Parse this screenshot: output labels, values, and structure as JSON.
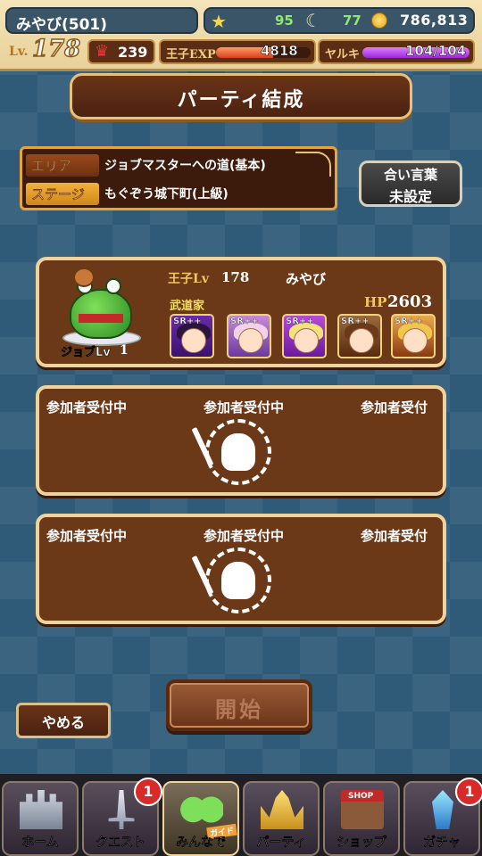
{
  "status": {
    "player_name": "みやび(501)",
    "stamina": "95",
    "gems": "77",
    "gold": "786,813",
    "level_label": "Lv.",
    "level": "178",
    "crowns": "239",
    "exp_label": "王子EXP",
    "exp_value": "4818",
    "exp_fill_percent": 60,
    "yaruki_label": "ヤルキ",
    "yaruki_value": "104/104",
    "yaruki_fill_percent": 100
  },
  "title": "パーティ結成",
  "area": {
    "area_key": "エリア",
    "area_value": "ジョブマスターへの道(基本)",
    "stage_key": "ステージ",
    "stage_value": "もぐぞう城下町(上級)"
  },
  "aikotoba": {
    "title": "合い言葉",
    "value": "未設定"
  },
  "leader": {
    "job_level_label": "ジョブLv",
    "job_level": "1",
    "prince_label": "王子Lv",
    "prince_level": "178",
    "name": "みやび",
    "job_name": "武道家",
    "hp_label": "HP",
    "hp": "2603",
    "units": [
      {
        "rarity": "SR++"
      },
      {
        "rarity": "SR++"
      },
      {
        "rarity": "SR++"
      },
      {
        "rarity": "SR++"
      },
      {
        "rarity": "SR++"
      }
    ]
  },
  "slots": [
    {
      "recruit_1": "参加者受付中",
      "recruit_2": "参加者受付中",
      "recruit_3": "参加者受付"
    },
    {
      "recruit_1": "参加者受付中",
      "recruit_2": "参加者受付中",
      "recruit_3": "参加者受付"
    }
  ],
  "buttons": {
    "start": "開始",
    "quit": "やめる"
  },
  "nav": {
    "items": [
      {
        "label": "ホーム",
        "badge": "",
        "icon": "castle-icon"
      },
      {
        "label": "クエスト",
        "badge": "1",
        "icon": "sword-icon"
      },
      {
        "label": "みんなで",
        "badge": "",
        "icon": "frogs-icon",
        "tag": "ガイド"
      },
      {
        "label": "パーティ",
        "badge": "",
        "icon": "tiara-icon"
      },
      {
        "label": "ショップ",
        "badge": "",
        "icon": "shop-icon",
        "tag": "SHOP"
      },
      {
        "label": "ガチャ",
        "badge": "1",
        "icon": "crystal-icon"
      }
    ]
  }
}
